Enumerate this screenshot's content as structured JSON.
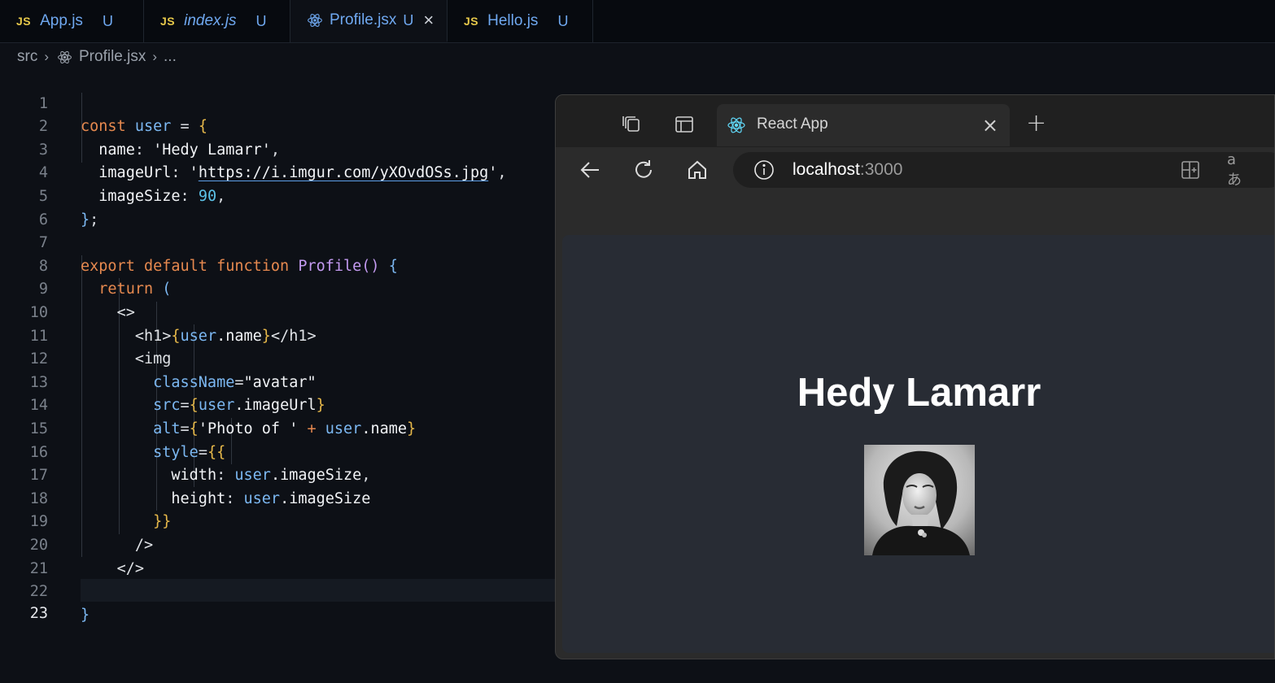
{
  "editor": {
    "tabs": [
      {
        "label": "App.js",
        "lang": "JS",
        "status": "U"
      },
      {
        "label": "index.js",
        "lang": "JS",
        "status": "U"
      },
      {
        "label": "Profile.jsx",
        "status": "U",
        "close": "×"
      },
      {
        "label": "Hello.js",
        "lang": "JS",
        "status": "U"
      }
    ],
    "breadcrumb": {
      "folder": "src",
      "file": "Profile.jsx",
      "more": "..."
    },
    "line_numbers": [
      "1",
      "2",
      "3",
      "4",
      "5",
      "6",
      "7",
      "8",
      "9",
      "10",
      "11",
      "12",
      "13",
      "14",
      "15",
      "16",
      "17",
      "18",
      "19",
      "20",
      "21",
      "22",
      "23"
    ],
    "code": {
      "l1": [
        "const",
        "user",
        "=",
        "{"
      ],
      "l2": [
        "name",
        ":",
        "'Hedy Lamarr'",
        ","
      ],
      "l3": [
        "imageUrl",
        ":",
        "'",
        "https://i.imgur.com/yXOvdOSs.jpg",
        "'",
        ","
      ],
      "l4": [
        "imageSize",
        ":",
        "90",
        ","
      ],
      "l5": [
        "}",
        ";"
      ],
      "l7": [
        "export",
        "default",
        "function",
        "Profile",
        "()",
        "{"
      ],
      "l8": [
        "return",
        "("
      ],
      "l9": [
        "<>"
      ],
      "l10": [
        "<h1>",
        "{",
        "user",
        ".name",
        "}",
        "</h1>"
      ],
      "l11": [
        "<img"
      ],
      "l12": [
        "className",
        "=",
        "\"avatar\""
      ],
      "l13": [
        "src",
        "=",
        "{",
        "user",
        ".imageUrl",
        "}"
      ],
      "l14": [
        "alt",
        "=",
        "{",
        "'Photo of '",
        "+",
        "user",
        ".name",
        "}"
      ],
      "l15": [
        "style",
        "=",
        "{{"
      ],
      "l16": [
        "width",
        ":",
        "user",
        ".imageSize",
        ","
      ],
      "l17": [
        "height",
        ":",
        "user",
        ".imageSize"
      ],
      "l18": [
        "}}"
      ],
      "l19": [
        "/>"
      ],
      "l20": [
        "</>"
      ],
      "l21": [
        ")",
        ";"
      ],
      "l22": [
        "}"
      ]
    }
  },
  "browser": {
    "tab_title": "React App",
    "tab_close": "×",
    "new_tab": "+",
    "address": {
      "host": "localhost",
      "port": ":3000"
    },
    "page": {
      "heading": "Hedy Lamarr",
      "image_alt": "Photo of Hedy Lamarr"
    }
  },
  "colors": {
    "editor_bg": "#0d1016",
    "keyword": "#e6894f",
    "function": "#c39af0",
    "variable": "#7cb8f2",
    "number": "#5cc2e8",
    "bracket": "#e6b84a",
    "page_bg": "#282c34"
  }
}
